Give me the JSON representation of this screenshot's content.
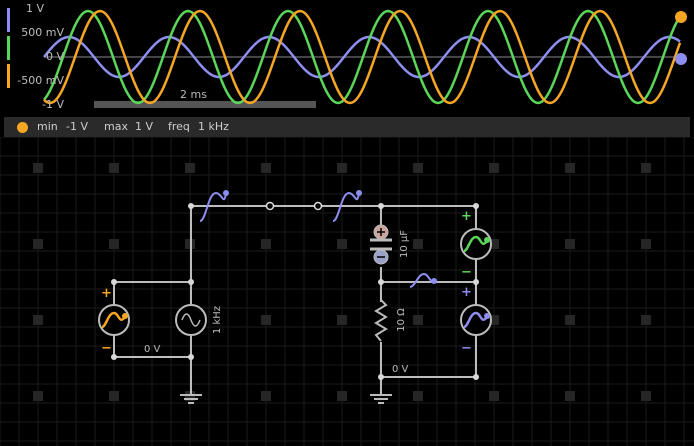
{
  "scope": {
    "y_labels": [
      "1 V",
      "500 mV",
      "0 V",
      "-500 mV",
      "-1 V"
    ],
    "time_label": "2 ms",
    "trace_colors": {
      "orange": "#f5a623",
      "green": "#5ad65a",
      "blue": "#8e8ef0"
    }
  },
  "status": {
    "min_key": "min",
    "min_val": "-1 V",
    "max_key": "max",
    "max_val": "1 V",
    "freq_key": "freq",
    "freq_val": "1 kHz",
    "dot_color": "#f5a623"
  },
  "circuit": {
    "source_freq": "1 kHz",
    "capacitor": "10 µF",
    "resistor": "10 Ω",
    "ground_label_left": "0 V",
    "ground_label_right": "0 V",
    "plus": "+",
    "minus": "−"
  }
}
